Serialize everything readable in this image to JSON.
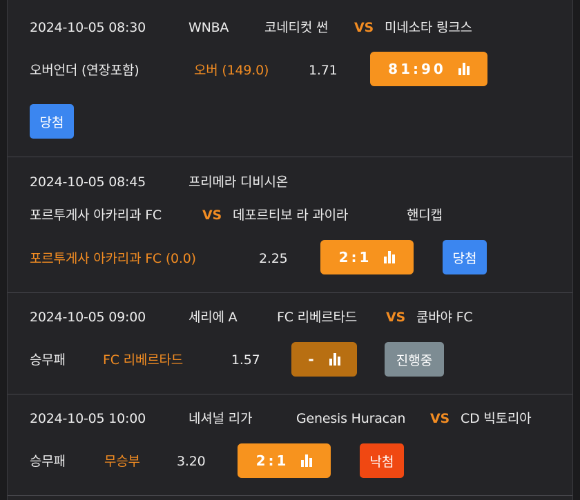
{
  "bets": [
    {
      "datetime": "2024-10-05 08:30",
      "league": "WNBA",
      "home": "코네티컷 썬",
      "vs": "VS",
      "away": "미네소타 링크스",
      "market": "오버언더 (연장포함)",
      "pick": "오버 (149.0)",
      "odds": "1.71",
      "score": "81:90",
      "status": "당첨"
    },
    {
      "datetime": "2024-10-05 08:45",
      "league": "프리메라 디비시온",
      "home": "포르투게사 아카리과 FC",
      "vs": "VS",
      "away": "데포르티보 라 과이라",
      "market": "핸디캡",
      "pick": "포르투게사 아카리과 FC (0.0)",
      "odds": "2.25",
      "score": "2:1",
      "status": "당첨"
    },
    {
      "datetime": "2024-10-05 09:00",
      "league": "세리에 A",
      "home": "FC 리베르타드",
      "vs": "VS",
      "away": "쿰바야 FC",
      "market": "승무패",
      "pick": "FC 리베르타드",
      "odds": "1.57",
      "score": "-",
      "status": "진행중"
    },
    {
      "datetime": "2024-10-05 10:00",
      "league": "네셔널 리가",
      "home": "Genesis Huracan",
      "vs": "VS",
      "away": "CD 빅토리아",
      "market": "승무패",
      "pick": "무승부",
      "odds": "3.20",
      "score": "2:1",
      "status": "낙첨"
    }
  ],
  "colors": {
    "accent": "#f7931e",
    "win": "#3b86f0",
    "lose": "#f04812",
    "in_progress": "#7d8c93"
  },
  "icons": {
    "stats": "bar-chart-icon"
  }
}
